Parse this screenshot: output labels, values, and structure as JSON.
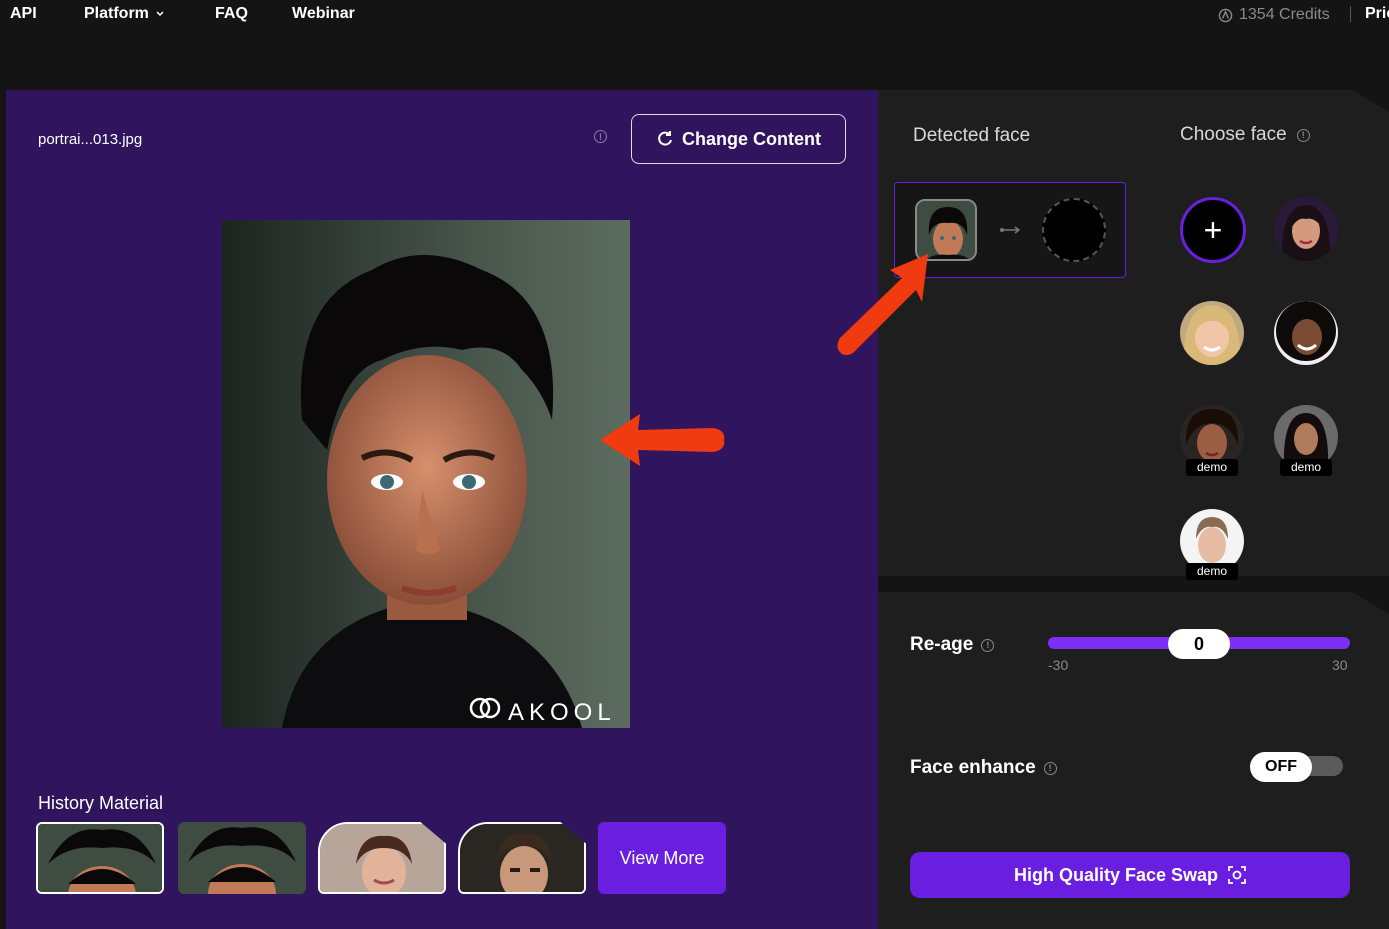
{
  "nav": {
    "items": [
      "API",
      "Platform",
      "FAQ",
      "Webinar"
    ],
    "credits": "1354 Credits",
    "pricing": "Pric"
  },
  "left": {
    "filename": "portrai...013.jpg",
    "change_content": "Change Content",
    "watermark": "AKOOL",
    "history_title": "History Material",
    "view_more": "View More"
  },
  "right": {
    "detected_face": "Detected face",
    "choose_face": "Choose face",
    "demo_label": "demo",
    "add_symbol": "+"
  },
  "controls": {
    "reage_label": "Re-age",
    "reage_value": "0",
    "reage_min": "-30",
    "reage_max": "30",
    "reage_level": 0.5,
    "enhance_label": "Face enhance",
    "enhance_state": "OFF",
    "swap_button": "High Quality Face Swap"
  },
  "colors": {
    "accent": "#6a1fe0",
    "slider": "#7b2ff7",
    "left_bg": "#30145e",
    "arrow": "#f03a10"
  }
}
